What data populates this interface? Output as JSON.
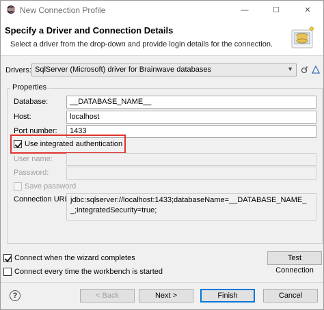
{
  "window": {
    "title": "New Connection Profile",
    "minimize": "—",
    "maximize": "☐",
    "close": "✕"
  },
  "banner": {
    "title": "Specify a Driver and Connection Details",
    "description": "Select a driver from the drop-down and provide login details for the connection."
  },
  "drivers": {
    "label": "Drivers:",
    "selected": "SqlServer (Microsoft) driver for Brainwave databases"
  },
  "properties": {
    "label": "Properties",
    "database": {
      "label": "Database:",
      "value": "__DATABASE_NAME__"
    },
    "host": {
      "label": "Host:",
      "value": "localhost"
    },
    "port": {
      "label": "Port number:",
      "value": "1433"
    },
    "integrated_auth": {
      "label": "Use integrated authentication",
      "checked": true
    },
    "user_name": {
      "label": "User name:",
      "value": ""
    },
    "password": {
      "label": "Password:",
      "value": ""
    },
    "save_password": {
      "label": "Save password",
      "checked": false
    },
    "connection_url": {
      "label": "Connection URL:",
      "value": "jdbc:sqlserver://localhost:1433;databaseName=__DATABASE_NAME__;integratedSecurity=true;"
    }
  },
  "options": {
    "connect_when_complete": {
      "label": "Connect when the wizard completes",
      "checked": true
    },
    "connect_every_time": {
      "label": "Connect every time the workbench is started",
      "checked": false
    }
  },
  "buttons": {
    "test_connection": "Test Connection",
    "back": "< Back",
    "next": "Next >",
    "finish": "Finish",
    "cancel": "Cancel",
    "help": "?"
  },
  "colors": {
    "highlight": "#e0322f",
    "primary_border": "#0078d7"
  }
}
